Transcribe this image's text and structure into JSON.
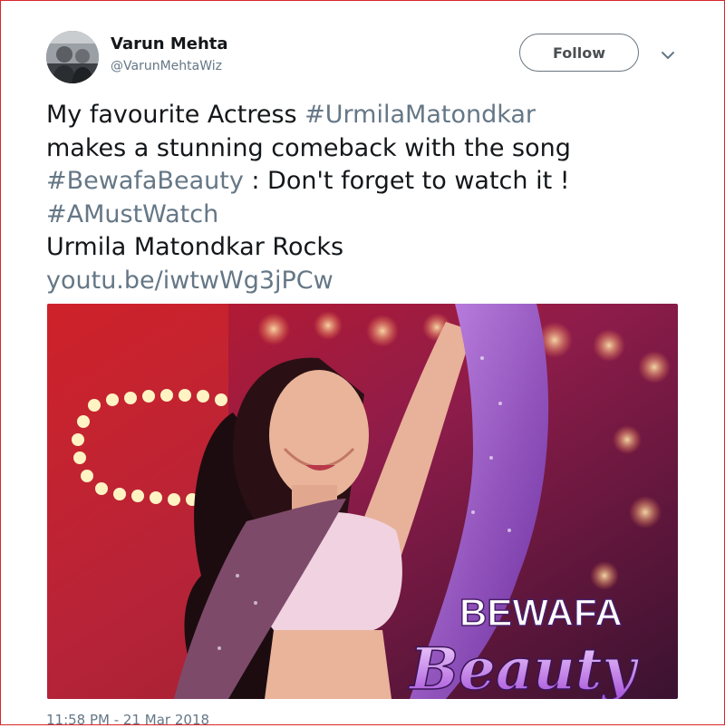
{
  "user": {
    "name": "Varun Mehta",
    "handle": "@VarunMehtaWiz"
  },
  "header": {
    "follow_label": "Follow",
    "menu_icon": "chevron-down-icon"
  },
  "tweet": {
    "line1_text": "My favourite Actress ",
    "line1_tag": "#UrmilaMatondkar",
    "line2_text": "makes a stunning comeback with the song",
    "line3_tag": "#BewafaBeauty",
    "line3_text": " : Don't forget to watch it !",
    "line4_tag": "#AMustWatch",
    "line5_text": "Urmila Matondkar Rocks",
    "link": "youtu.be/iwtwWg3jPCw"
  },
  "media": {
    "title_word1": "BEWAFA",
    "title_word2": "Beauty"
  },
  "footer": {
    "timestamp": "11:58 PM - 21 Mar 2018"
  },
  "colors": {
    "border_red": "#d9262b",
    "text_dark": "#14171a",
    "text_grey": "#657786",
    "media_purple": "#9b3fc8"
  }
}
